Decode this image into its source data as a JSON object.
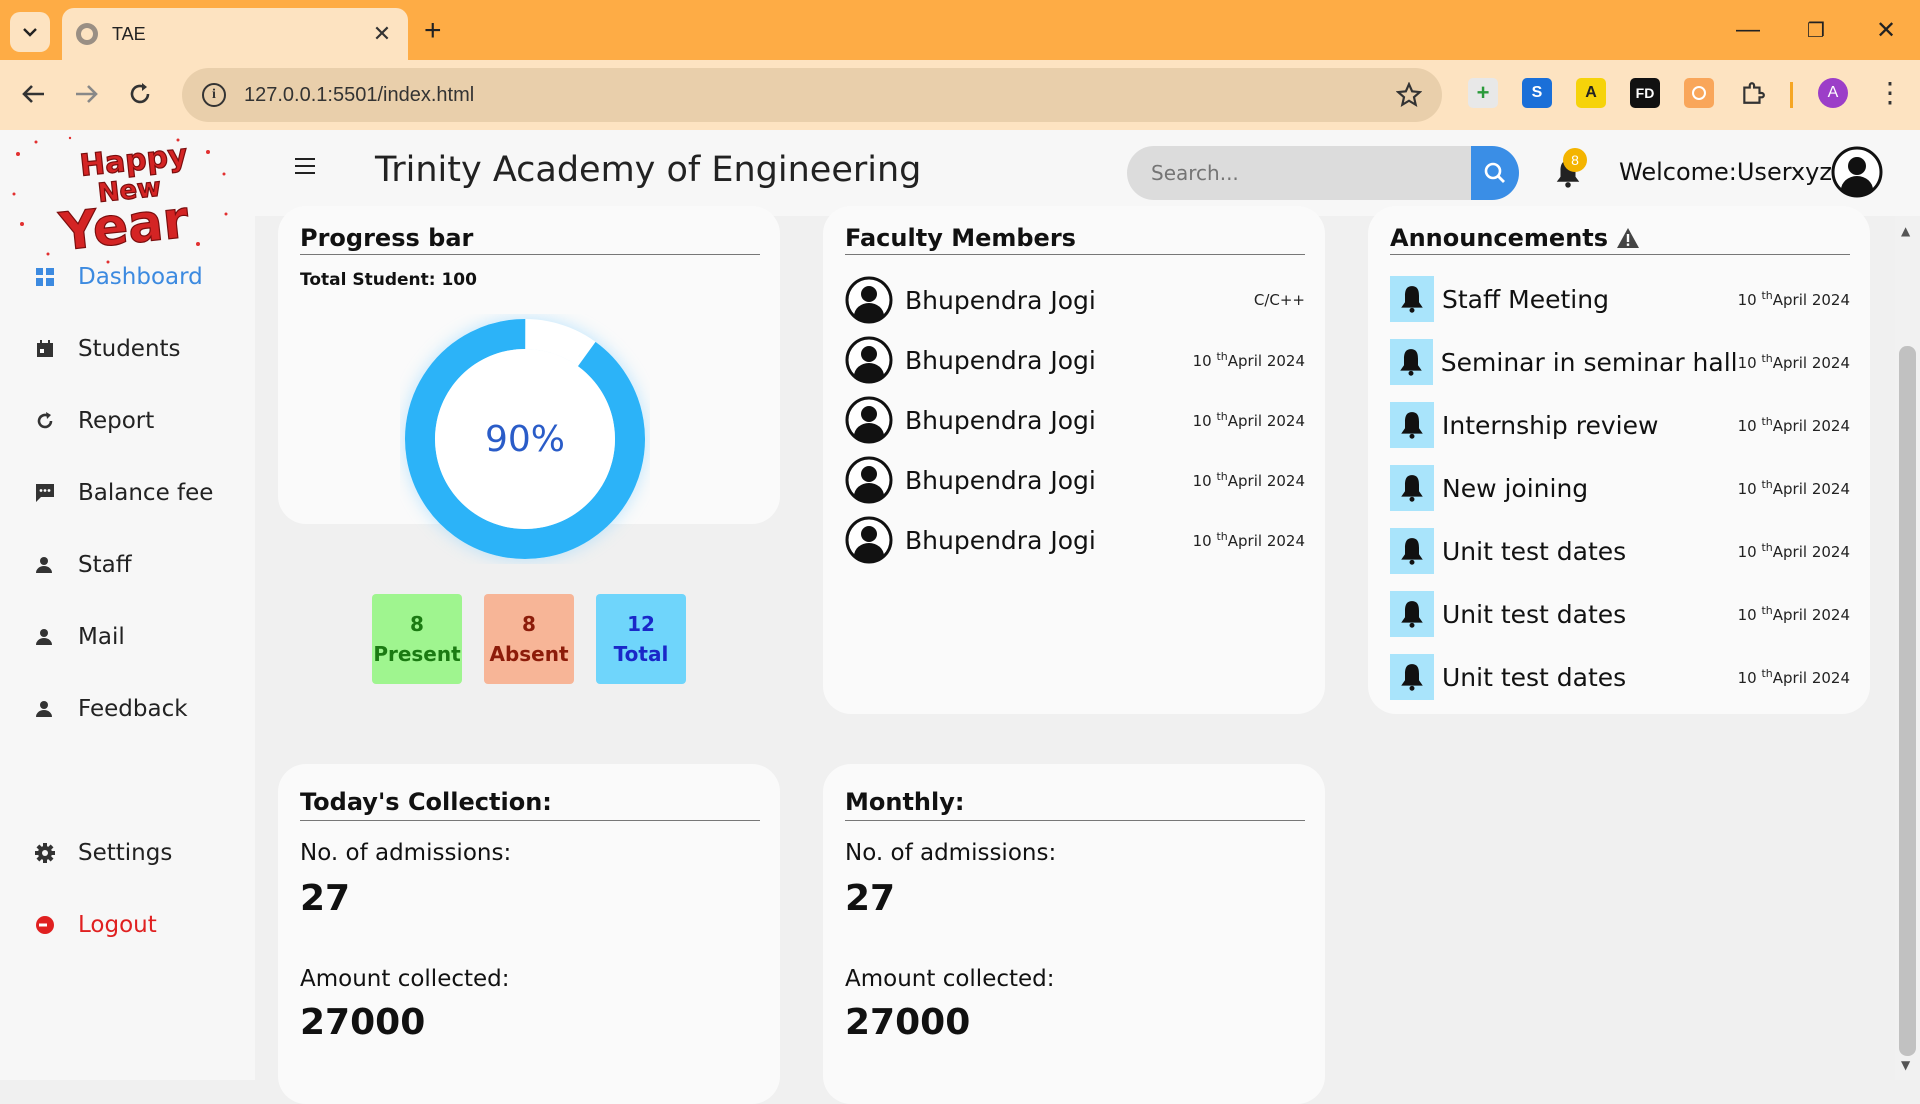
{
  "browser": {
    "tab_title": "TAE",
    "tab_close": "✕",
    "new_tab": "+",
    "url": "127.0.0.1:5501/index.html",
    "window": {
      "minimize": "—",
      "restore": "❐",
      "close": "✕"
    },
    "extensions": [
      "plus-extension-icon",
      "s-extension-icon",
      "a-extension-icon",
      "fd-extension-icon",
      "orange-extension-icon",
      "puzzle-icon"
    ],
    "ext_labels": {
      "s": "S",
      "a": "A",
      "fd": "FD"
    },
    "profile_initial": "A",
    "accent": "#feac45"
  },
  "header": {
    "title": "Trinity Academy of Engineering",
    "search_placeholder": "Search...",
    "notification_count": "8",
    "welcome": "Welcome:Userxyz"
  },
  "logo": {
    "lines": [
      "Happy",
      "New",
      "Year"
    ]
  },
  "sidebar": {
    "items": [
      {
        "label": "Dashboard",
        "icon": "grid-icon",
        "active": true
      },
      {
        "label": "Students",
        "icon": "calendar-icon"
      },
      {
        "label": "Report",
        "icon": "refresh-icon"
      },
      {
        "label": "Balance fee",
        "icon": "chat-icon"
      },
      {
        "label": "Staff",
        "icon": "user-icon"
      },
      {
        "label": "Mail",
        "icon": "user-icon"
      },
      {
        "label": "Feedback",
        "icon": "user-icon"
      }
    ],
    "settings": "Settings",
    "logout": "Logout"
  },
  "progress": {
    "title": "Progress bar",
    "total_students": "Total Student: 100",
    "percent_label": "90%",
    "percent": 90,
    "present": {
      "count": "8",
      "label": "Present"
    },
    "absent": {
      "count": "8",
      "label": "Absent"
    },
    "total": {
      "count": "12",
      "label": "Total"
    }
  },
  "faculty": {
    "title": "Faculty Members",
    "members": [
      {
        "name": "Bhupendra Jogi",
        "meta": "C/C++",
        "day": "",
        "sup": "",
        "month": ""
      },
      {
        "name": "Bhupendra Jogi",
        "day": "10 ",
        "sup": "th",
        "month": "April 2024"
      },
      {
        "name": "Bhupendra Jogi",
        "day": "10 ",
        "sup": "th",
        "month": "April 2024"
      },
      {
        "name": "Bhupendra Jogi",
        "day": "10 ",
        "sup": "th",
        "month": "April 2024"
      },
      {
        "name": "Bhupendra Jogi",
        "day": "10 ",
        "sup": "th",
        "month": "April 2024"
      }
    ]
  },
  "announcements": {
    "title": "Announcements",
    "items": [
      {
        "text": "Staff Meeting",
        "day": "10 ",
        "sup": "th",
        "month": "April 2024"
      },
      {
        "text": "Seminar in seminar hall",
        "day": "10 ",
        "sup": "th",
        "month": "April 2024"
      },
      {
        "text": "Internship review",
        "day": "10 ",
        "sup": "th",
        "month": "April 2024"
      },
      {
        "text": "New joining",
        "day": "10 ",
        "sup": "th",
        "month": "April 2024"
      },
      {
        "text": "Unit test dates",
        "day": "10 ",
        "sup": "th",
        "month": "April 2024"
      },
      {
        "text": "Unit test dates",
        "day": "10 ",
        "sup": "th",
        "month": "April 2024"
      },
      {
        "text": "Unit test dates",
        "day": "10 ",
        "sup": "th",
        "month": "April 2024"
      }
    ]
  },
  "today": {
    "title": "Today's Collection:",
    "admissions_label": "No. of admissions:",
    "admissions": "27",
    "amount_label": "Amount collected:",
    "amount": "27000"
  },
  "monthly": {
    "title": "Monthly:",
    "admissions_label": "No. of admissions:",
    "admissions": "27",
    "amount_label": "Amount collected:",
    "amount": "27000"
  }
}
